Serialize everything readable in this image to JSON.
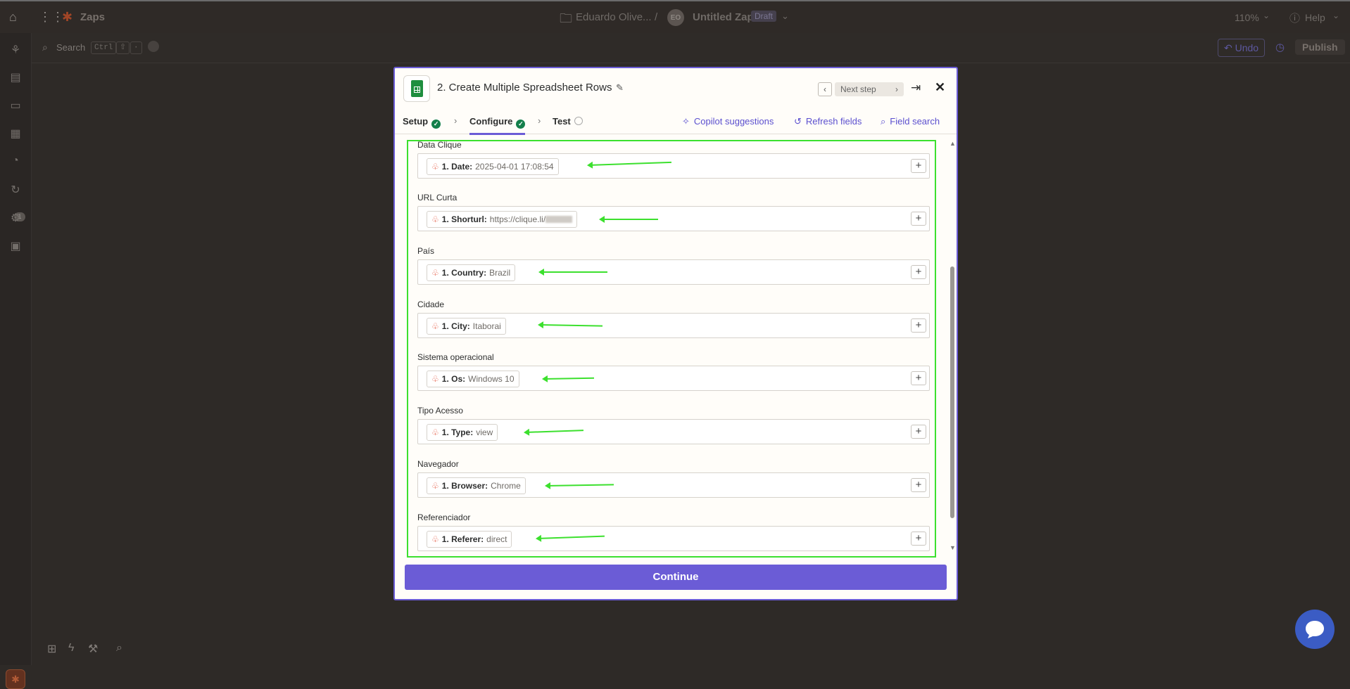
{
  "topbar": {
    "app_name": "Zaps",
    "owner": "Eduardo Olive...",
    "separator": "/",
    "avatar_initials": "EO",
    "zap_title": "Untitled Zap",
    "status_badge": "Draft",
    "zoom": "110%",
    "help_label": "Help"
  },
  "canvas_toolbar": {
    "search_label": "Search",
    "shortcut_ctrl": "Ctrl",
    "undo_label": "Undo",
    "publish_label": "Publish"
  },
  "sidebar": {
    "notification_count": "1"
  },
  "modal": {
    "step_title": "2. Create Multiple Spreadsheet Rows",
    "next_step_label": "Next step",
    "tabs": [
      {
        "label": "Setup",
        "status": "complete"
      },
      {
        "label": "Configure",
        "status": "complete"
      },
      {
        "label": "Test",
        "status": "pending"
      }
    ],
    "tools": {
      "copilot": "Copilot suggestions",
      "refresh": "Refresh fields",
      "field_search": "Field search"
    },
    "fields": [
      {
        "label": "Data Clique",
        "pill_key": "1. Date:",
        "pill_value": "2025-04-01 17:08:54"
      },
      {
        "label": "URL Curta",
        "pill_key": "1. Shorturl:",
        "pill_value": "https://clique.li/"
      },
      {
        "label": "País",
        "pill_key": "1. Country:",
        "pill_value": "Brazil"
      },
      {
        "label": "Cidade",
        "pill_key": "1. City:",
        "pill_value": "Itaborai"
      },
      {
        "label": "Sistema operacional",
        "pill_key": "1. Os:",
        "pill_value": "Windows 10"
      },
      {
        "label": "Tipo Acesso",
        "pill_key": "1. Type:",
        "pill_value": "view"
      },
      {
        "label": "Navegador",
        "pill_key": "1. Browser:",
        "pill_value": "Chrome"
      },
      {
        "label": "Referenciador",
        "pill_key": "1. Referer:",
        "pill_value": "direct"
      }
    ],
    "continue_label": "Continue"
  },
  "colors": {
    "accent": "#6b5cd6",
    "highlight": "#3ce02e",
    "success": "#137f4b",
    "zapier_orange": "#e2553d"
  }
}
